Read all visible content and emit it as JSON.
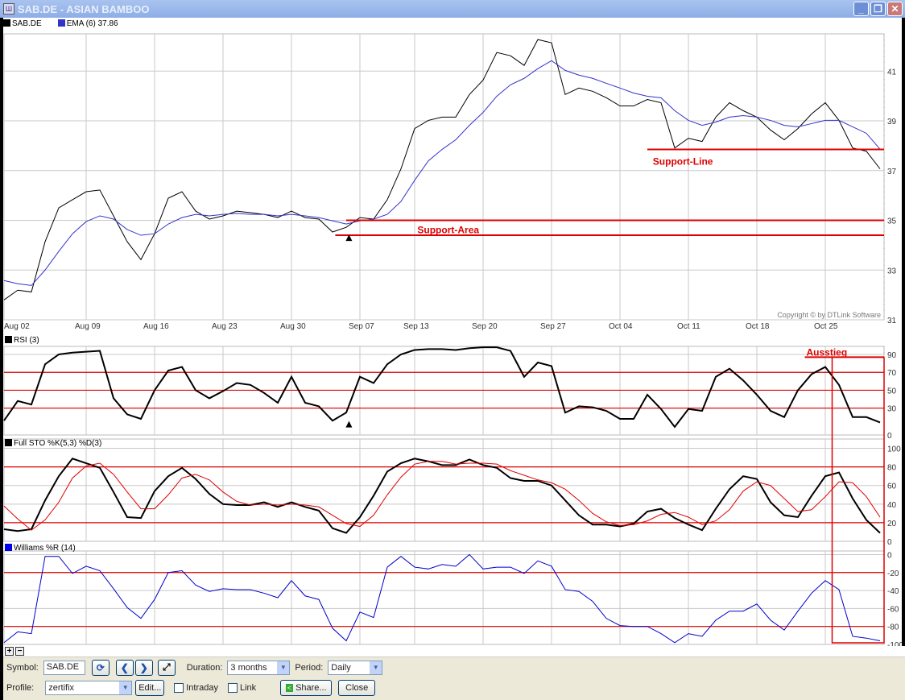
{
  "window": {
    "title": "SAB.DE - ASIAN BAMBOO",
    "app_icon": "chart-icon"
  },
  "legend": {
    "price": "SAB.DE",
    "ema": "EMA (6) 37.86",
    "rsi": "RSI (3)",
    "sto": "Full STO %K(5,3) %D(3)",
    "williams": "Williams %R (14)"
  },
  "colors": {
    "price": "#000000",
    "ema": "#3333cc",
    "rsi": "#000000",
    "k": "#000000",
    "d": "#dd0000",
    "williams": "#0000cc",
    "annotation": "#dd0000",
    "grid": "#c8c8c8"
  },
  "copyright": "Copyright © by DTLink Software",
  "toolbar": {
    "symbol_label": "Symbol:",
    "symbol_value": "SAB.DE",
    "duration_label": "Duration:",
    "duration_value": "3 months",
    "period_label": "Period:",
    "period_value": "Daily",
    "profile_label": "Profile:",
    "profile_value": "zertifix",
    "edit_label": "Edit...",
    "intraday_label": "Intraday",
    "link_label": "Link",
    "share_label": "Share...",
    "close_label": "Close",
    "intraday_checked": false,
    "link_checked": false
  },
  "chart_data": [
    {
      "type": "line",
      "title": "SAB.DE - ASIAN BAMBOO",
      "ylim": [
        31,
        42.5
      ],
      "yticks": [
        41,
        39,
        37,
        35,
        33,
        31
      ],
      "x_labels": [
        {
          "i": 0,
          "t": "Aug 02"
        },
        {
          "i": 6,
          "t": "Aug 09"
        },
        {
          "i": 11,
          "t": "Aug 16"
        },
        {
          "i": 16,
          "t": "Aug 23"
        },
        {
          "i": 21,
          "t": "Aug 30"
        },
        {
          "i": 26,
          "t": "Sep 07"
        },
        {
          "i": 30,
          "t": "Sep 13"
        },
        {
          "i": 35,
          "t": "Sep 20"
        },
        {
          "i": 40,
          "t": "Sep 27"
        },
        {
          "i": 45,
          "t": "Oct 04"
        },
        {
          "i": 50,
          "t": "Oct 11"
        },
        {
          "i": 55,
          "t": "Oct 18"
        },
        {
          "i": 60,
          "t": "Oct 25"
        }
      ],
      "series": [
        {
          "name": "SAB.DE",
          "values": [
            31.8,
            32.19,
            32.12,
            34.14,
            35.5,
            35.83,
            36.15,
            36.22,
            35.18,
            34.14,
            33.42,
            34.46,
            35.89,
            36.15,
            35.37,
            35.05,
            35.18,
            35.37,
            35.31,
            35.24,
            35.11,
            35.37,
            35.11,
            35.05,
            34.53,
            34.72,
            35.11,
            35.05,
            35.83,
            37.07,
            38.69,
            39.02,
            39.15,
            39.15,
            40.06,
            40.64,
            41.75,
            41.62,
            41.23,
            42.27,
            42.14,
            40.06,
            40.32,
            40.19,
            39.93,
            39.6,
            39.6,
            39.86,
            39.73,
            37.91,
            38.3,
            38.17,
            39.15,
            39.73,
            39.41,
            39.15,
            38.63,
            38.24,
            38.69,
            39.28,
            39.73,
            39.02,
            37.91,
            37.78,
            37.07
          ]
        },
        {
          "name": "EMA (6)",
          "values": [
            32.58,
            32.45,
            32.38,
            33.0,
            33.75,
            34.46,
            34.95,
            35.18,
            35.05,
            34.63,
            34.4,
            34.46,
            34.85,
            35.11,
            35.24,
            35.18,
            35.24,
            35.28,
            35.24,
            35.24,
            35.18,
            35.24,
            35.18,
            35.11,
            34.98,
            34.85,
            34.98,
            35.05,
            35.24,
            35.76,
            36.61,
            37.39,
            37.85,
            38.24,
            38.82,
            39.34,
            39.99,
            40.45,
            40.71,
            41.1,
            41.42,
            41.03,
            40.84,
            40.71,
            40.51,
            40.32,
            40.12,
            39.99,
            39.93,
            39.41,
            39.02,
            38.82,
            38.95,
            39.15,
            39.21,
            39.15,
            39.02,
            38.82,
            38.76,
            38.89,
            39.02,
            39.02,
            38.76,
            38.5,
            37.86
          ]
        }
      ],
      "annotations": [
        {
          "label": "Support-Line",
          "level": 37.85,
          "from": 47,
          "label_i": 47.4,
          "label_level": 37.4
        },
        {
          "label": "Support-Area",
          "level": 35.0,
          "from": 25,
          "label_i": 30.2,
          "label_level": 34.65
        },
        {
          "label": "",
          "level": 34.4,
          "from": 24.2
        }
      ],
      "markers": [
        {
          "i": 25.2,
          "level": 34.3
        }
      ]
    },
    {
      "type": "line",
      "title": "RSI (3)",
      "ylim": [
        0,
        99
      ],
      "yticks": [
        90,
        70,
        50,
        30,
        0
      ],
      "ref_lines": [
        70,
        50,
        30
      ],
      "series": [
        {
          "name": "RSI (3)",
          "values": [
            16,
            38,
            34,
            79,
            90,
            92,
            93,
            94,
            41,
            23,
            18,
            50,
            72,
            76,
            50,
            41,
            49,
            58,
            56,
            47,
            36,
            65,
            36,
            32,
            16,
            25,
            65,
            58,
            79,
            90,
            95,
            96,
            96,
            95,
            97,
            98,
            98,
            94,
            65,
            81,
            77,
            25,
            32,
            31,
            27,
            18,
            18,
            45,
            29,
            9,
            29,
            27,
            65,
            74,
            61,
            45,
            27,
            20,
            50,
            68,
            76,
            56,
            20,
            20,
            14
          ]
        }
      ],
      "annotations": [
        {
          "label": "Ausstieg",
          "level": 87,
          "from": 58.5
        }
      ],
      "markers": [
        {
          "i": 25.2,
          "level": 12
        }
      ]
    },
    {
      "type": "line",
      "title": "Full STO %K(5,3) %D(3)",
      "ylim": [
        0,
        110
      ],
      "yticks": [
        100,
        80,
        60,
        40,
        20,
        0
      ],
      "ref_lines": [
        80,
        20
      ],
      "series": [
        {
          "name": "%K",
          "values": [
            13,
            11,
            13,
            44,
            70,
            89,
            84,
            79,
            53,
            26,
            25,
            54,
            70,
            79,
            67,
            51,
            40,
            39,
            39,
            42,
            37,
            42,
            37,
            33,
            14,
            9,
            26,
            49,
            75,
            84,
            89,
            86,
            82,
            82,
            88,
            82,
            79,
            68,
            65,
            65,
            60,
            44,
            28,
            18,
            18,
            16,
            19,
            32,
            35,
            25,
            18,
            12,
            35,
            56,
            70,
            67,
            42,
            28,
            26,
            49,
            70,
            74,
            46,
            23,
            9
          ]
        },
        {
          "name": "%D",
          "values": [
            38,
            24,
            12,
            23,
            42,
            68,
            81,
            84,
            72,
            53,
            35,
            35,
            50,
            68,
            72,
            66,
            53,
            43,
            39,
            40,
            39,
            40,
            39,
            37,
            28,
            19,
            16,
            28,
            50,
            69,
            83,
            86,
            86,
            83,
            84,
            84,
            83,
            76,
            71,
            66,
            63,
            56,
            44,
            30,
            21,
            17,
            18,
            22,
            29,
            31,
            26,
            18,
            22,
            34,
            54,
            64,
            60,
            46,
            32,
            34,
            48,
            64,
            63,
            48,
            26
          ]
        }
      ]
    },
    {
      "type": "line",
      "title": "Williams %R (14)",
      "ylim": [
        -100,
        4
      ],
      "yticks": [
        0,
        -20,
        -40,
        -60,
        -80,
        -100
      ],
      "ref_lines": [
        -20,
        -80
      ],
      "series": [
        {
          "name": "Williams %R",
          "values": [
            -98,
            -86,
            -88,
            -2,
            -2,
            -21,
            -13,
            -18,
            -38,
            -59,
            -71,
            -50,
            -20,
            -18,
            -34,
            -41,
            -38,
            -39,
            -39,
            -43,
            -48,
            -29,
            -46,
            -50,
            -82,
            -96,
            -64,
            -70,
            -14,
            -2,
            -14,
            -16,
            -11,
            -13,
            0,
            -16,
            -14,
            -14,
            -21,
            -7,
            -13,
            -39,
            -41,
            -52,
            -71,
            -79,
            -80,
            -80,
            -88,
            -98,
            -88,
            -91,
            -73,
            -63,
            -63,
            -55,
            -73,
            -84,
            -63,
            -43,
            -29,
            -39,
            -91,
            -93,
            -96
          ]
        }
      ]
    }
  ]
}
